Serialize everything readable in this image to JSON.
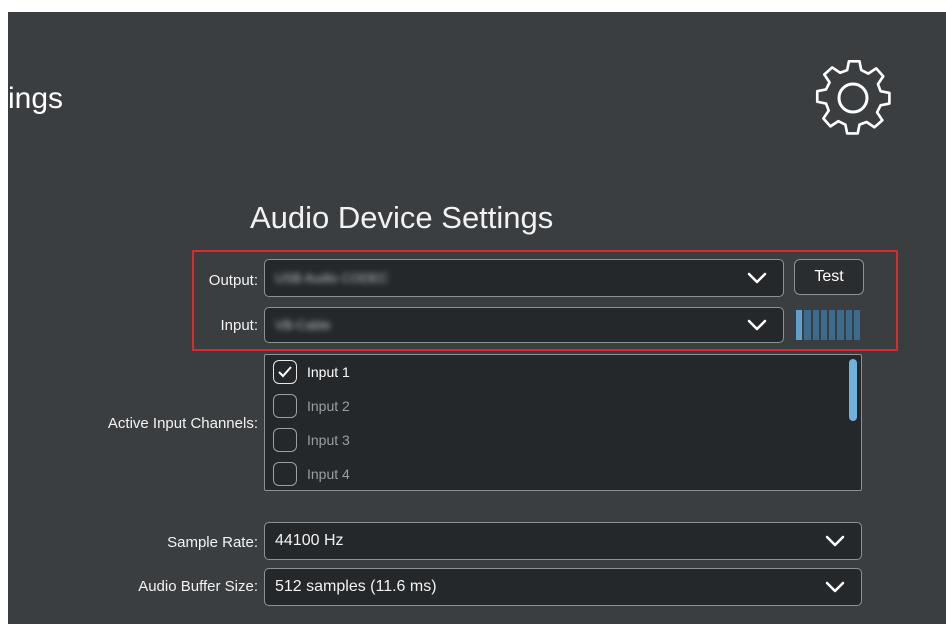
{
  "header": {
    "title": "ings",
    "settings_icon": "gear-icon"
  },
  "section": {
    "title": "Audio Device Settings"
  },
  "output": {
    "label": "Output:",
    "value": "USB Audio CODEC",
    "test_label": "Test"
  },
  "input": {
    "label": "Input:",
    "value": "VB-Cable",
    "level_meter": {
      "cells": 8,
      "lit": 1
    }
  },
  "channels": {
    "label": "Active Input Channels:",
    "items": [
      {
        "label": "Input 1",
        "checked": true
      },
      {
        "label": "Input 2",
        "checked": false
      },
      {
        "label": "Input 3",
        "checked": false
      },
      {
        "label": "Input 4",
        "checked": false
      }
    ]
  },
  "sample_rate": {
    "label": "Sample Rate:",
    "value": "44100 Hz"
  },
  "buffer_size": {
    "label": "Audio Buffer Size:",
    "value": "512 samples (11.6 ms)"
  },
  "colors": {
    "background": "#3a3e41",
    "highlight": "#d92b2b",
    "meter_lit": "#5fa0cd",
    "scrollbar": "#6fb3dd"
  }
}
